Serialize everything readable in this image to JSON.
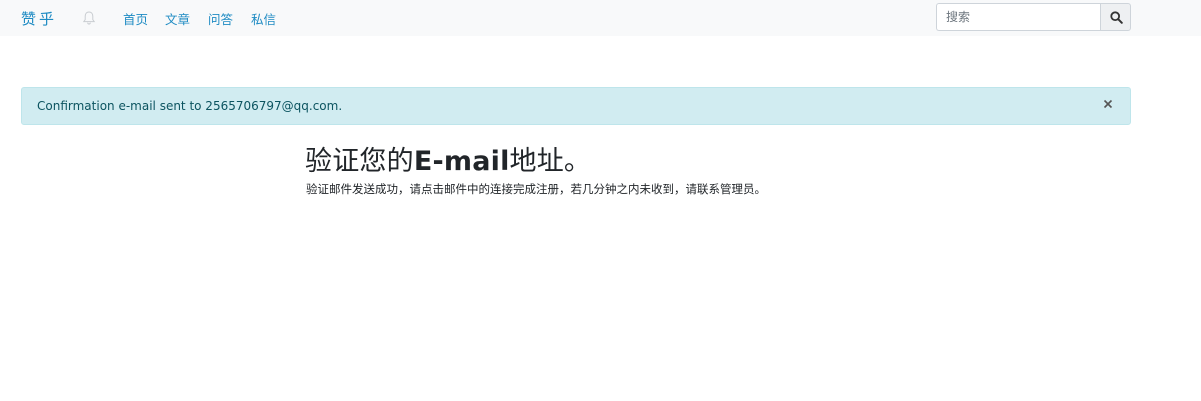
{
  "navbar": {
    "brand": "赞乎",
    "nav_links": [
      "首页",
      "文章",
      "问答",
      "私信"
    ],
    "notification_icon": "bell-icon",
    "search": {
      "placeholder": "搜索",
      "value": "",
      "button_icon": "search-icon"
    }
  },
  "alert": {
    "message": "Confirmation e-mail sent to 2565706797@qq.com.",
    "close_symbol": "×",
    "close_icon": "close-icon",
    "background_color": "#d1ecf1",
    "text_color": "#0c5460"
  },
  "main": {
    "title_prefix": "验证您的",
    "title_latin": "E-mail",
    "title_suffix": "地址。",
    "description": "验证邮件发送成功，请点击邮件中的连接完成注册，若几分钟之内未收到，请联系管理员。"
  },
  "colors": {
    "accent": "#1e8bc3",
    "navbar_bg": "#f8f9fa"
  }
}
